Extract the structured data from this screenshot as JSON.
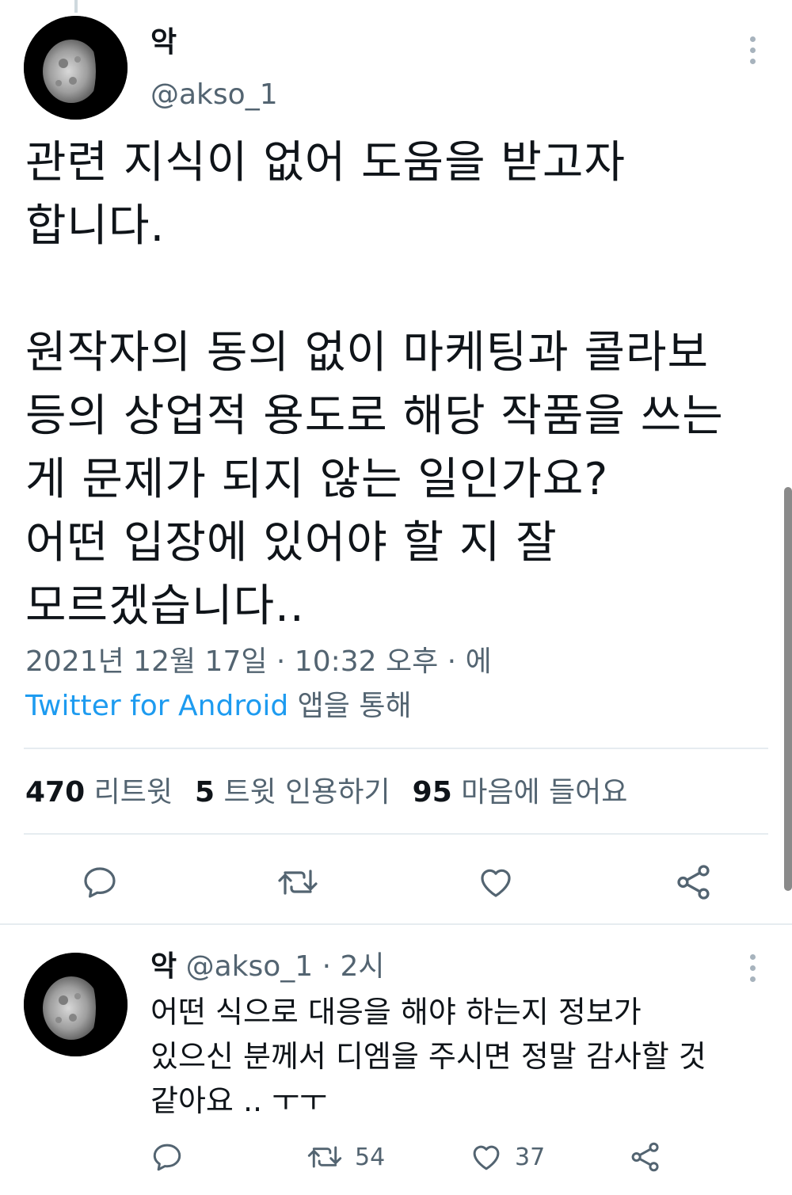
{
  "tweet": {
    "display_name": "악",
    "handle": "@akso_1",
    "text": "관련 지식이 없어 도움을 받고자\n합니다.\n\n원작자의 동의 없이 마케팅과 콜라보\n등의 상업적 용도로 해당 작품을 쓰는\n게 문제가 되지 않는 일인가요?\n어떤 입장에 있어야 할 지 잘\n모르겠습니다..",
    "timestamp": "2021년 12월 17일 · 10:32 오후 · 에",
    "source_app": "Twitter for Android",
    "source_suffix": " 앱을 통해",
    "stats": {
      "retweets_count": "470",
      "retweets_label": "리트윗",
      "quotes_count": "5",
      "quotes_label": "트윗 인용하기",
      "likes_count": "95",
      "likes_label": "마음에 들어요"
    }
  },
  "reply": {
    "display_name": "악",
    "handle": "@akso_1",
    "time": " · 2시",
    "text": "어떤 식으로 대응을 해야 하는지 정보가\n있으신 분께서 디엠을 주시면 정말 감사할 것\n같아요 .. ㅜㅜ",
    "retweet_count": "54",
    "like_count": "37"
  },
  "icons": {
    "reply": "reply-icon",
    "retweet": "retweet-icon",
    "like": "heart-icon",
    "share": "share-icon",
    "more": "more-vertical-icon"
  },
  "colors": {
    "accent": "#1d9bf0",
    "secondary_text": "#536471",
    "divider": "#e6ecf0"
  }
}
